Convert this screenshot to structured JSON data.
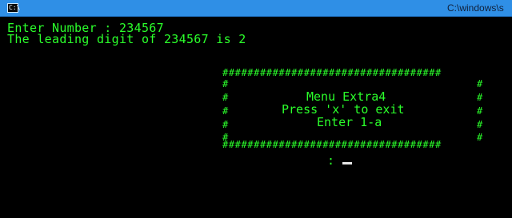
{
  "window": {
    "title": "C:\\windows\\s",
    "icon": "console-icon",
    "icon_glyph": "C:\\",
    "colors": {
      "titlebar": "#2f8fe6",
      "background": "#000000",
      "text": "#2bff2b",
      "cursor": "#e7e7e7"
    }
  },
  "console": {
    "lines": [
      "Enter Number : 234567",
      "The leading digit of 234567 is 2"
    ],
    "menu_box": {
      "border_row": "###################################",
      "side_char": "#",
      "items": [
        "Menu Extra4",
        "Press 'x' to exit",
        "Enter 1-a"
      ]
    },
    "prompt": ":"
  }
}
